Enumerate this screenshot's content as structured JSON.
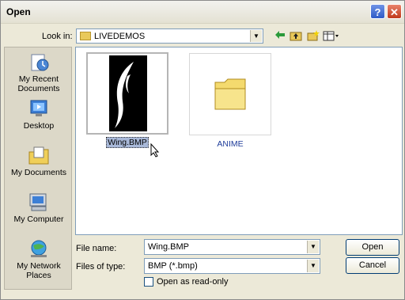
{
  "window": {
    "title": "Open",
    "help_glyph": "?",
    "close_glyph": "✕"
  },
  "lookin": {
    "label": "Look in:",
    "value": "LIVEDEMOS",
    "arrow": "▼"
  },
  "toolbar": {
    "back_icon": "back-arrow-icon",
    "up_icon": "up-folder-icon",
    "new_folder_icon": "new-folder-icon",
    "views_icon": "views-menu-icon"
  },
  "places": [
    {
      "label": "My Recent Documents",
      "icon": "recent-documents-icon"
    },
    {
      "label": "Desktop",
      "icon": "desktop-icon"
    },
    {
      "label": "My Documents",
      "icon": "my-documents-icon"
    },
    {
      "label": "My Computer",
      "icon": "my-computer-icon"
    },
    {
      "label": "My Network Places",
      "icon": "network-places-icon"
    }
  ],
  "files": [
    {
      "name": "Wing.BMP",
      "type": "bitmap",
      "selected": true
    },
    {
      "name": "ANIME",
      "type": "folder",
      "selected": false
    }
  ],
  "filename": {
    "label": "File name:",
    "value": "Wing.BMP",
    "arrow": "▼"
  },
  "filetype": {
    "label": "Files of type:",
    "value": "BMP (*.bmp)",
    "arrow": "▼"
  },
  "readonly": {
    "label": "Open as read-only",
    "checked": false
  },
  "buttons": {
    "open": "Open",
    "cancel": "Cancel"
  },
  "colors": {
    "folder_label": "#1f3d9a",
    "title_bar": "#ece9d8",
    "selection": "#316ac5"
  }
}
